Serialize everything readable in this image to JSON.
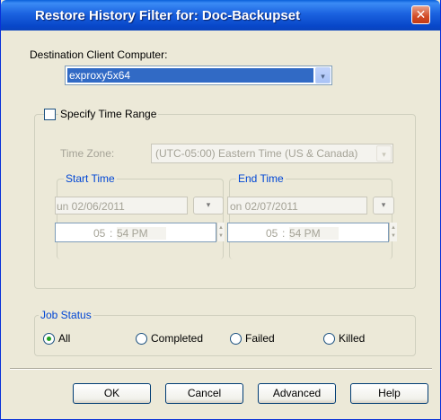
{
  "window": {
    "title": "Restore History Filter for: Doc-Backupset",
    "close_glyph": "✕"
  },
  "destination": {
    "label": "Destination Client Computer:",
    "selected_value": "exproxy5x64",
    "arrow_glyph": "▾"
  },
  "time_range": {
    "checkbox_label": "Specify Time Range",
    "checked": false,
    "timezone_label": "Time Zone:",
    "timezone_value": "(UTC-05:00) Eastern Time (US & Canada)",
    "arrow_glyph": "▾",
    "start": {
      "legend": "Start Time",
      "date": "un 02/06/2011",
      "hour": "05",
      "sep": ":",
      "minute_ampm": "54 PM",
      "date_btn": "▾"
    },
    "end": {
      "legend": "End Time",
      "date": "on 02/07/2011",
      "hour": "05",
      "sep": ":",
      "minute_ampm": "54 PM",
      "date_btn": "▾"
    }
  },
  "job_status": {
    "legend": "Job Status",
    "options": [
      {
        "label": "All",
        "selected": true
      },
      {
        "label": "Completed",
        "selected": false
      },
      {
        "label": "Failed",
        "selected": false
      },
      {
        "label": "Killed",
        "selected": false
      }
    ]
  },
  "buttons": {
    "ok": "OK",
    "cancel": "Cancel",
    "advanced": "Advanced",
    "help": "Help"
  },
  "colors": {
    "title_bar": "#0a5fd9",
    "selection": "#316ac5",
    "radio_dot": "#21a121",
    "close": "#d24b26"
  }
}
